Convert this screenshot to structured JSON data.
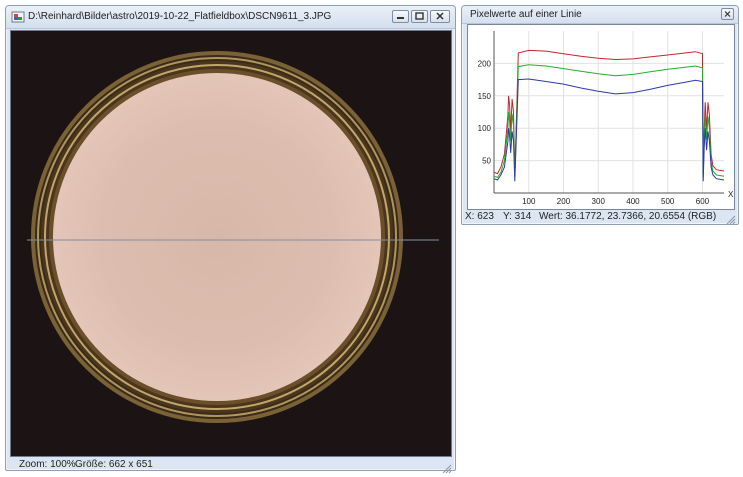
{
  "image_window": {
    "title": "D:\\Reinhard\\Bilder\\astro\\2019-10-22_Flatfieldbox\\DSCN9611_3.JPG",
    "status": {
      "zoom": "Zoom: 100%",
      "size": "Größe: 662 x 651"
    }
  },
  "line_window": {
    "title": "Pixelwerte auf einer Linie",
    "status": {
      "x": "X: 623",
      "y": "Y: 314",
      "value": "Wert: 36.1772, 23.7366, 20.6554 (RGB)"
    }
  },
  "colors": {
    "red_channel": "#c0282d",
    "green_channel": "#22b02a",
    "blue_channel": "#2c3aa8",
    "frame": "#dce6f2"
  },
  "chart_data": {
    "type": "line",
    "title": "",
    "xlabel": "X",
    "ylabel": "",
    "xlim": [
      0,
      662
    ],
    "ylim": [
      0,
      250
    ],
    "x_ticks": [
      100,
      200,
      300,
      400,
      500,
      600
    ],
    "y_ticks": [
      50,
      100,
      150,
      200
    ],
    "grid": true,
    "series": [
      {
        "color": "#c0282d",
        "x": [
          0,
          10,
          20,
          30,
          35,
          40,
          42,
          45,
          48,
          52,
          56,
          60,
          70,
          100,
          150,
          200,
          250,
          300,
          350,
          400,
          450,
          500,
          550,
          580,
          600,
          602,
          605,
          608,
          612,
          616,
          620,
          625,
          630,
          640,
          662
        ],
        "y": [
          32,
          30,
          40,
          60,
          90,
          120,
          150,
          135,
          95,
          145,
          125,
          30,
          216,
          220,
          219,
          215,
          211,
          208,
          206,
          207,
          210,
          213,
          216,
          218,
          215,
          30,
          100,
          140,
          98,
          140,
          120,
          60,
          42,
          36,
          34
        ]
      },
      {
        "color": "#22b02a",
        "x": [
          0,
          10,
          20,
          30,
          35,
          40,
          42,
          45,
          48,
          52,
          56,
          60,
          70,
          100,
          150,
          200,
          250,
          300,
          350,
          400,
          450,
          500,
          550,
          580,
          600,
          602,
          605,
          608,
          612,
          616,
          620,
          625,
          630,
          640,
          662
        ],
        "y": [
          26,
          24,
          32,
          50,
          75,
          100,
          125,
          110,
          80,
          122,
          105,
          24,
          195,
          198,
          196,
          192,
          188,
          184,
          181,
          183,
          187,
          191,
          194,
          196,
          193,
          24,
          85,
          120,
          82,
          118,
          100,
          48,
          34,
          28,
          26
        ]
      },
      {
        "color": "#2c3aa8",
        "x": [
          0,
          10,
          20,
          30,
          35,
          40,
          42,
          45,
          48,
          52,
          56,
          60,
          70,
          100,
          150,
          200,
          250,
          300,
          350,
          400,
          450,
          500,
          550,
          580,
          600,
          602,
          605,
          608,
          612,
          616,
          620,
          625,
          630,
          640,
          662
        ],
        "y": [
          22,
          20,
          28,
          40,
          60,
          80,
          100,
          88,
          62,
          95,
          80,
          18,
          175,
          176,
          172,
          168,
          162,
          157,
          153,
          155,
          160,
          166,
          171,
          174,
          172,
          18,
          70,
          100,
          66,
          95,
          80,
          40,
          28,
          22,
          20
        ]
      }
    ]
  }
}
